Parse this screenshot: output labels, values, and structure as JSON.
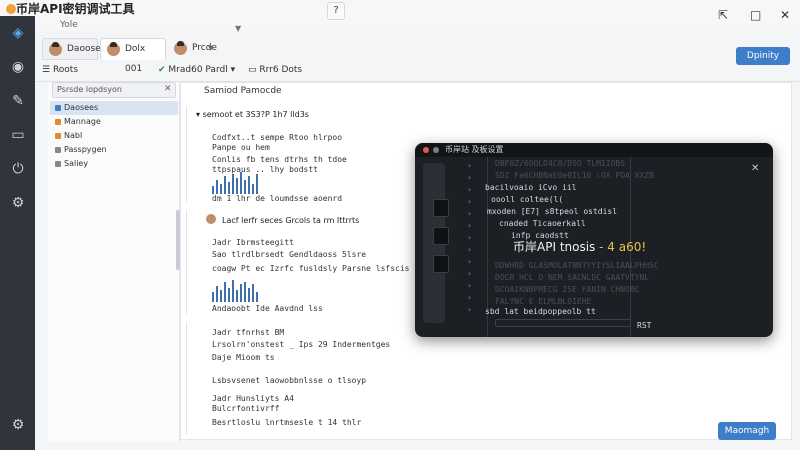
{
  "app": {
    "title": "币岸API密钥调试工具",
    "subtitle": "Yole",
    "center_button": "?",
    "window_controls": [
      "⇱",
      "□",
      "✕"
    ]
  },
  "rail": {
    "items": [
      {
        "icon": "cube-icon",
        "glyph": "◈"
      },
      {
        "icon": "chat-icon",
        "glyph": "◉"
      },
      {
        "icon": "pencil-icon",
        "glyph": "✎"
      },
      {
        "icon": "window-icon",
        "glyph": "▭"
      },
      {
        "icon": "power-icon",
        "glyph": "⏻"
      },
      {
        "icon": "gear-icon",
        "glyph": "⚙"
      },
      {
        "icon": "settings-icon",
        "glyph": "⚙"
      }
    ]
  },
  "tabs": [
    {
      "label": "Daoose"
    },
    {
      "label": "Dolx 001"
    },
    {
      "label": "Prcde"
    }
  ],
  "primary_button": "Dpinity",
  "toolbar": {
    "roots_label": "Roots",
    "model_label": "Mrad60 Pardl ▾",
    "data_label": "Rrr6 Dots"
  },
  "panel": {
    "search_placeholder": "Psrsde lopdsyon",
    "items": [
      {
        "label": "Daosees",
        "color": "#3e7dc8"
      },
      {
        "label": "Mannage",
        "color": "#e08a2e"
      },
      {
        "label": "Nabl",
        "color": "#e08a2e"
      },
      {
        "label": "Passpygen",
        "color": "#888888"
      },
      {
        "label": "Saliey",
        "color": "#888888"
      }
    ]
  },
  "content": {
    "title": "Samiod Pamocde",
    "header_line": "semoot et 3S3?P    1h7 lld3s",
    "block1": [
      "Codfxt..t sempe  Rtoo  hlrpoo",
      "Panpe ou hem",
      "Conlis fb  tens  dtrhs  th  tdoe",
      "ttpspaus  ..  lhy  bodstt"
    ],
    "block1_foot": "dm 1 lhr  de loumdsse  aoenrd",
    "block2_head": "Lacf lerfr  seces  Grcols  ta  rm  Ittrrts",
    "block2": [
      "Jadr Ibrmsteegitt",
      "Sao  tlrdlbrsedt  Gendldaoss  5lsre",
      "coagw  Pt ec  Izrfc  fusldsly  Parsne  lsfscis"
    ],
    "block2_foot": "Andaoobt Ide  Aavdnd  lss",
    "block3": [
      "Jadr tfnrhst  BM",
      "Lrsolrn'onstest  _  Ips  29  Indermentges",
      "Daje Mioom  ts",
      "Lsbsvsenet  laowobbnlsse  o  tlsoyp",
      "Jadr Hunsliyts  A4",
      "Bulcrfontivrff",
      "Besrtloslu  lnrtmsesle  t  14  thlr"
    ]
  },
  "terminal": {
    "title": "币岸站  及板设置",
    "lines_dim": [
      "DBF0Z/6OOLD4C8/DSO TLM1IOBS",
      "SDI  Fa6CHBNaE0e0IL10 cOX  POA  XXZB"
    ],
    "lines": [
      "bacilvoaio  iCvo  iil",
      "oooll coltee(l(",
      "mxoden [E7] s8tpeol ostdisl",
      "cnaded  Ticaoerkall",
      "infp  caodstt",
      "sbd lat  beidpoppeolb   tt"
    ],
    "highlight_main": "币岸API",
    "highlight_rest": " tnosis",
    "highlight_accent": " - 4 a60!",
    "dim_rows": [
      "DDWHRD  GLASMOLATNNTYYIYSLIAALPHHSC",
      "DOCR  HCL  O  NEM  SACNLDC  GAATVTYNL",
      "DCOAIKNBPMECG  ISE  FANIN  CHNOBC",
      "FALYNC  E  ELMLBLOIEHE"
    ],
    "footer_text": "RST"
  },
  "bottom_button": "Maomagh"
}
